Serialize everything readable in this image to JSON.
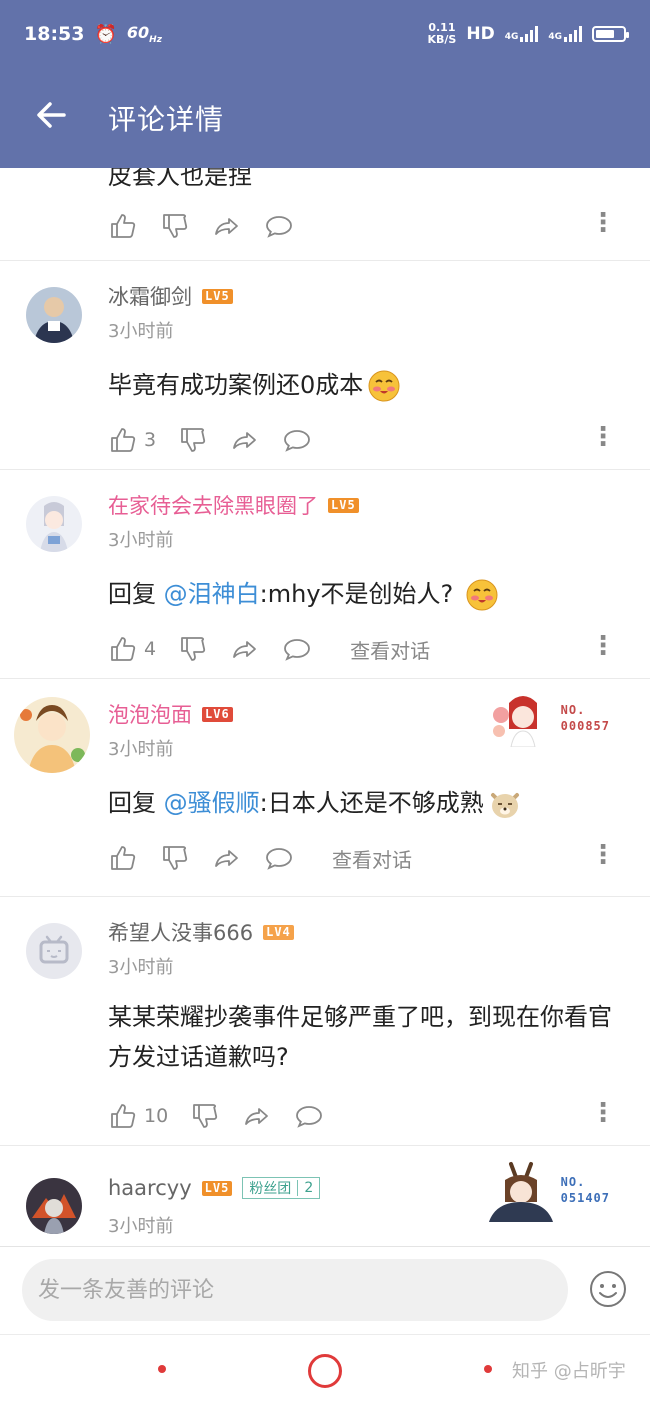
{
  "status_bar": {
    "time": "18:53",
    "hz": "60",
    "speed_value": "0.11",
    "speed_unit": "KB/S",
    "hd": "HD",
    "network": "4G"
  },
  "header": {
    "title": "评论详情"
  },
  "partial_comment": {
    "text": "皮套人也是捏"
  },
  "comments": [
    {
      "user": "冰霜御剑",
      "level": "LV5",
      "time": "3小时前",
      "text": "毕竟有成功案例还0成本",
      "likes": "3",
      "view_conversation": ""
    },
    {
      "user": "在家待会去除黑眼圈了",
      "level": "LV5",
      "time": "3小时前",
      "reply_prefix": "回复",
      "mention": "@泪神白",
      "text": ":mhy不是创始人?",
      "likes": "4",
      "view_conversation": "查看对话"
    },
    {
      "user": "泡泡泡面",
      "level": "LV6",
      "time": "3小时前",
      "reply_prefix": "回复",
      "mention": "@骚假顺",
      "text": ":日本人还是不够成熟",
      "likes": "",
      "view_conversation": "查看对话",
      "badge_no": "NO.",
      "badge_num": "000857"
    },
    {
      "user": "希望人没事666",
      "level": "LV4",
      "time": "3小时前",
      "text": "某某荣耀抄袭事件足够严重了吧，到现在你看官方发过话道歉吗?",
      "likes": "10",
      "view_conversation": ""
    },
    {
      "user": "haarcyy",
      "level": "LV5",
      "fan_label": "粉丝团",
      "fan_level": "2",
      "time": "3小时前",
      "badge_no": "NO.",
      "badge_num": "051407"
    }
  ],
  "input": {
    "placeholder": "发一条友善的评论"
  },
  "watermark": "知乎 @占昕宇",
  "colors": {
    "header": "#6272aa",
    "pink_name": "#e75e94",
    "mention": "#3d8ed6",
    "lv5": "#f0902a",
    "lv6": "#e04b3a",
    "lv4": "#f5a24a",
    "nav_red": "#e03a3a"
  }
}
